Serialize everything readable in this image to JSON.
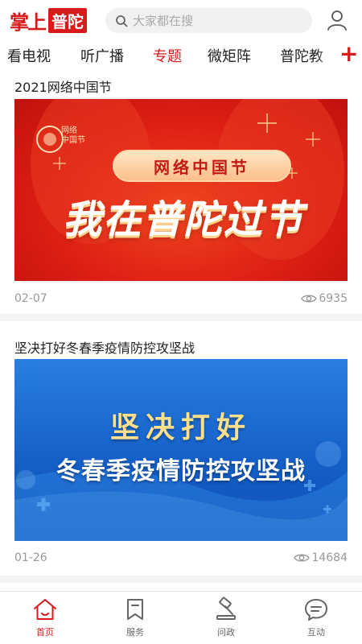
{
  "header": {
    "logo_part1": "掌上",
    "logo_part2": "普陀",
    "search_placeholder": "大家都在搜"
  },
  "tabs": {
    "items": [
      {
        "label": "看电视",
        "active": false
      },
      {
        "label": "听广播",
        "active": false
      },
      {
        "label": "专题",
        "active": true
      },
      {
        "label": "微矩阵",
        "active": false
      },
      {
        "label": "普陀教",
        "active": false
      }
    ],
    "add_label": "+"
  },
  "feed": [
    {
      "title": "2021网络中国节",
      "banner_logo_text": "网络\n中国节",
      "banner_pill": "网络中国节",
      "banner_headline": "我在普陀过节",
      "date": "02-07",
      "views": "6935"
    },
    {
      "title": "坚决打好冬春季疫情防控攻坚战",
      "banner_line1": "坚决打好",
      "banner_line2": "冬春季疫情防控攻坚战",
      "date": "01-26",
      "views": "14684"
    }
  ],
  "bottom_nav": {
    "items": [
      {
        "label": "首页",
        "icon": "home-icon",
        "active": true
      },
      {
        "label": "服务",
        "icon": "bookmark-icon",
        "active": false
      },
      {
        "label": "问政",
        "icon": "gavel-icon",
        "active": false
      },
      {
        "label": "互动",
        "icon": "chat-icon",
        "active": false
      }
    ]
  },
  "colors": {
    "accent": "#d71a1b",
    "background": "#f4f4f4",
    "muted_text": "#999999"
  }
}
